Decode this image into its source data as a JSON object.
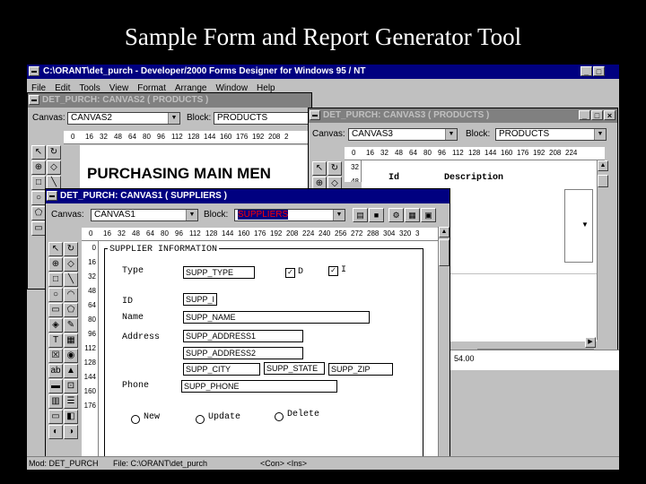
{
  "slide": {
    "title": "Sample Form and Report Generator Tool"
  },
  "app": {
    "title": "C:\\ORANT\\det_purch - Developer/2000 Forms Designer for Windows 95 / NT",
    "menu": [
      "File",
      "Edit",
      "Tools",
      "View",
      "Format",
      "Arrange",
      "Window",
      "Help"
    ]
  },
  "canvas2_win": {
    "title": "DET_PURCH: CANVAS2 ( PRODUCTS )",
    "canvas_label": "Canvas:",
    "canvas_value": "CANVAS2",
    "block_label": "Block:",
    "block_value": "PRODUCTS",
    "ruler": [
      "0",
      "16",
      "32",
      "48",
      "64",
      "80",
      "96",
      "112",
      "128",
      "144",
      "160",
      "176",
      "192",
      "208",
      "2"
    ],
    "heading": "PURCHASING MAIN MEN"
  },
  "canvas3_win": {
    "title": "DET_PURCH: CANVAS3 ( PRODUCTS )",
    "canvas_label": "Canvas:",
    "canvas_value": "CANVAS3",
    "block_label": "Block:",
    "block_value": "PRODUCTS",
    "ruler": [
      "0",
      "16",
      "32",
      "48",
      "64",
      "80",
      "96",
      "112",
      "128",
      "144",
      "160",
      "176",
      "192",
      "208",
      "224"
    ],
    "vruler": [
      "32",
      "48"
    ],
    "col_id": "Id",
    "col_desc": "Description",
    "value_54": "54.00"
  },
  "canvas1_win": {
    "title": "DET_PURCH: CANVAS1 ( SUPPLIERS )",
    "canvas_label": "Canvas:",
    "canvas_value": "CANVAS1",
    "block_label": "Block:",
    "block_value": "SUPPLIERS",
    "ruler": [
      "0",
      "16",
      "32",
      "48",
      "64",
      "80",
      "96",
      "112",
      "128",
      "144",
      "160",
      "176",
      "192",
      "208",
      "224",
      "240",
      "256",
      "272",
      "288",
      "304",
      "320",
      "3"
    ],
    "vruler": [
      "0",
      "16",
      "32",
      "48",
      "64",
      "80",
      "96",
      "112",
      "128",
      "144",
      "160",
      "176"
    ],
    "frame_title": "SUPPLIER INFORMATION",
    "labels": {
      "type": "Type",
      "id": "ID",
      "name": "Name",
      "address": "Address",
      "phone": "Phone"
    },
    "fields": {
      "supp_type": "SUPP_TYPE",
      "supp_i": "SUPP_I",
      "supp_name": "SUPP_NAME",
      "supp_address1": "SUPP_ADDRESS1",
      "supp_address2": "SUPP_ADDRESS2",
      "supp_city": "SUPP_CITY",
      "supp_state": "SUPP_STATE",
      "supp_zip": "SUPP_ZIP",
      "supp_phone": "SUPP_PHONE"
    },
    "checks": {
      "d": "D",
      "i": "I"
    },
    "radios": {
      "new": "New",
      "update": "Update",
      "delete": "Delete"
    }
  },
  "status": {
    "mod": "Mod: DET_PURCH",
    "file": "File: C:\\ORANT\\det_purch",
    "keys": "<Con> <Ins>"
  },
  "colors": {
    "titlebar_active": "#000080",
    "titlebar_inactive": "#808080",
    "window_face": "#c0c0c0",
    "block_highlight_text": "#ff0000"
  }
}
